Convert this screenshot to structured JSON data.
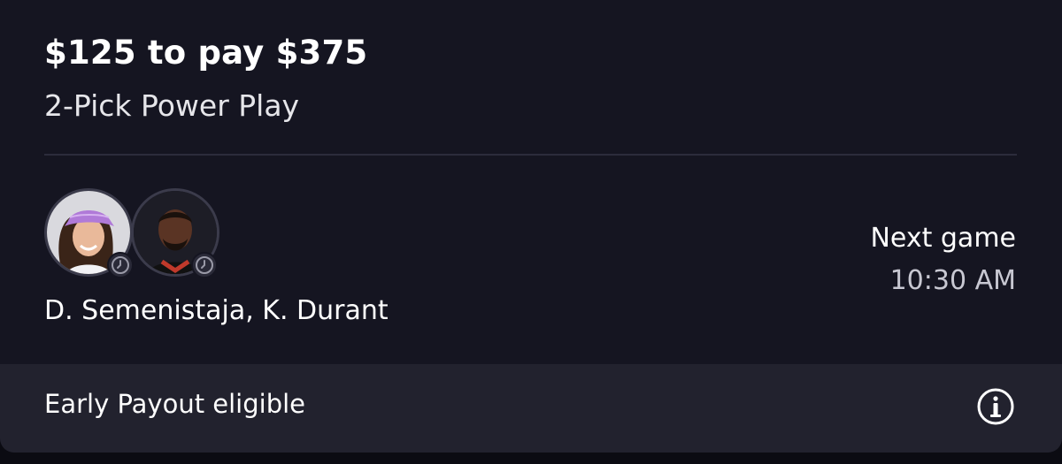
{
  "entry": {
    "title": "$125 to pay $375",
    "subtitle": "2-Pick Power Play"
  },
  "picks": {
    "players": [
      {
        "name": "D. Semenistaja",
        "icon": "player-avatar",
        "status_icon": "clock-icon"
      },
      {
        "name": "K. Durant",
        "icon": "player-avatar",
        "status_icon": "clock-icon"
      }
    ],
    "names_text": "D. Semenistaja, K. Durant"
  },
  "next_game": {
    "label": "Next game",
    "time": "10:30 AM"
  },
  "footer": {
    "text": "Early Payout eligible",
    "icon": "info-icon"
  },
  "colors": {
    "background": "#151521",
    "footer_background": "#22222e",
    "text_primary": "#ffffff",
    "text_secondary": "#c8c8d2",
    "visor": "#b07ad8"
  }
}
